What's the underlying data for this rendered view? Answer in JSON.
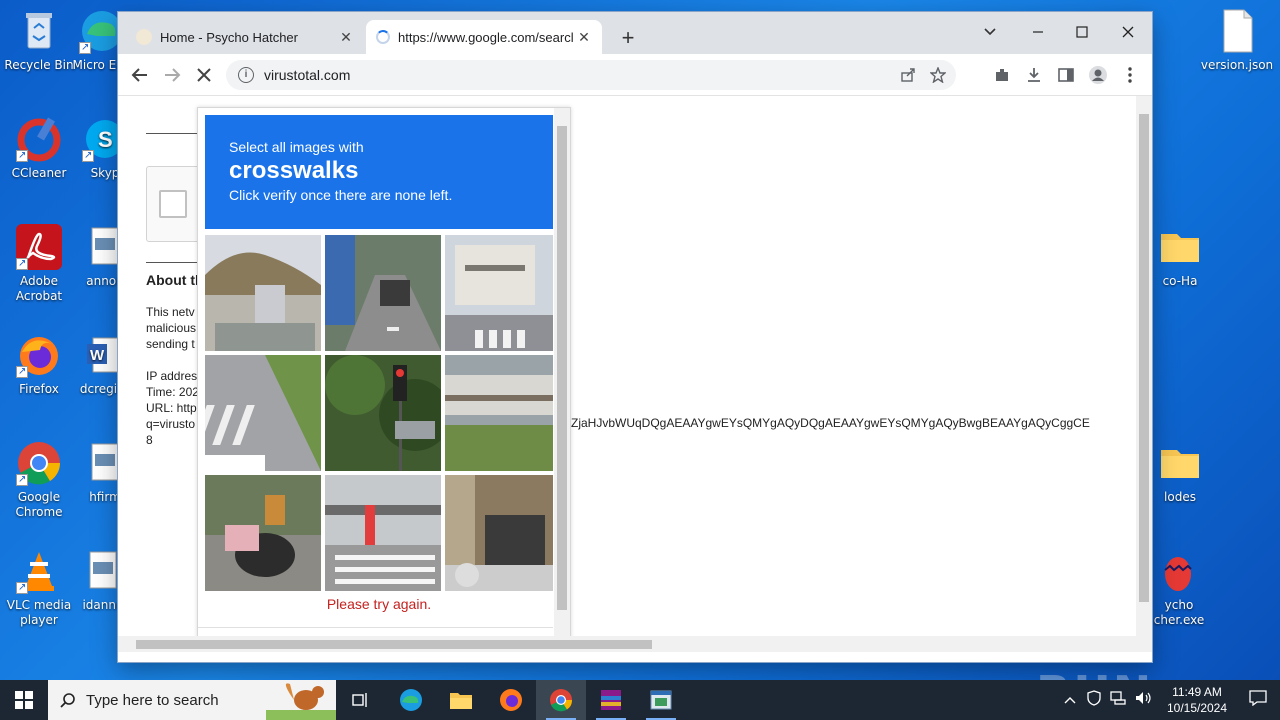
{
  "desktop": {
    "icons": [
      {
        "label": "Recycle Bin"
      },
      {
        "label": "Micro Edg"
      },
      {
        "label": "CCleaner"
      },
      {
        "label": "Skyp"
      },
      {
        "label": "Adobe Acrobat"
      },
      {
        "label": "annou"
      },
      {
        "label": "Firefox"
      },
      {
        "label": "dcregist"
      },
      {
        "label": "Google Chrome"
      },
      {
        "label": "hfirm"
      },
      {
        "label": "VLC media player"
      },
      {
        "label": "idannu"
      },
      {
        "label": "version.json"
      },
      {
        "label": "co-Ha"
      },
      {
        "label": "lodes"
      },
      {
        "label": "ycho cher.exe"
      }
    ]
  },
  "browser": {
    "tabs": [
      {
        "title": "Home - Psycho Hatcher",
        "close": "✕"
      },
      {
        "title": "https://www.google.com/searcl",
        "close": "✕"
      }
    ],
    "new_tab": "+",
    "url": "virustotal.com"
  },
  "page": {
    "about_heading": "About th",
    "para_lines": [
      "This netv",
      "malicious",
      "sending t"
    ],
    "details_lines": [
      "IP addres",
      "Time: 202",
      "URL: http",
      "q=virusto",
      "8"
    ],
    "long_token": "ZjaHJvbWUqDQgAEAAYgwEYsQMYgAQyDQgAEAAYgwEYsQMYgAQyBwgBEAAYgAQyCggCE"
  },
  "captcha": {
    "prompt_line1": "Select all images with",
    "prompt_target": "crosswalks",
    "prompt_line3": "Click verify once there are none left.",
    "error": "Please try again.",
    "accent": "#1a73e8"
  },
  "taskbar": {
    "search_placeholder": "Type here to search",
    "time": "11:49 AM",
    "date": "10/15/2024"
  },
  "watermark": "ANY RUN"
}
